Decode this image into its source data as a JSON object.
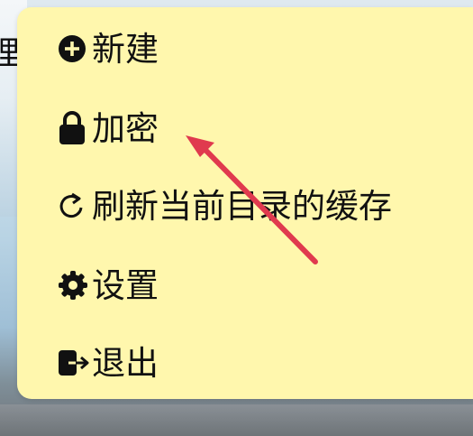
{
  "background": {
    "partial_text": "理"
  },
  "menu": {
    "items": [
      {
        "label": "新建",
        "icon": "plus-circle-icon"
      },
      {
        "label": "加密",
        "icon": "lock-icon"
      },
      {
        "label": "刷新当前目录的缓存",
        "icon": "refresh-icon"
      },
      {
        "label": "设置",
        "icon": "gear-icon"
      },
      {
        "label": "退出",
        "icon": "logout-icon"
      }
    ]
  },
  "annotation": {
    "arrow_color": "#e03a4e",
    "points_to": "加密"
  },
  "colors": {
    "menu_background": "#fff7ad",
    "text": "#111111"
  }
}
